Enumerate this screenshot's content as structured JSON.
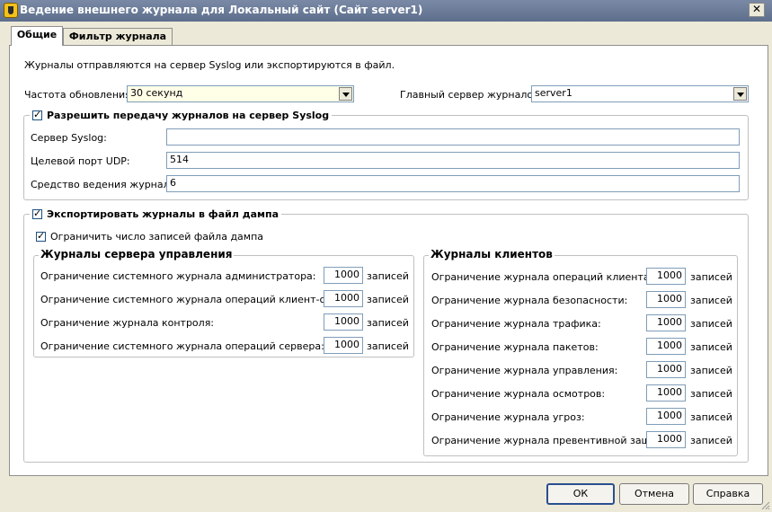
{
  "window": {
    "title": "Ведение внешнего журнала для Локальный сайт (Сайт server1)",
    "close": "✕"
  },
  "tabs": [
    "Общие",
    "Фильтр журнала"
  ],
  "intro": "Журналы отправляются на сервер Syslog или экспортируются в файл.",
  "refresh": {
    "label": "Частота обновления:",
    "value": "30 секунд"
  },
  "main_server": {
    "label": "Главный сервер журналов:",
    "value": "server1"
  },
  "syslog": {
    "enable_label": "Разрешить передачу журналов на сервер Syslog",
    "server_label": "Сервер Syslog:",
    "server_value": "",
    "port_label": "Целевой порт UDP:",
    "port_value": "514",
    "facility_label": "Средство ведения журнала:",
    "facility_value": "6"
  },
  "export": {
    "enable_label": "Экспортировать журналы в файл дампа",
    "limit_label": "Ограничить число записей файла дампа",
    "server_logs": {
      "title": "Журналы сервера управления",
      "rows": [
        {
          "label": "Ограничение системного журнала администратора:",
          "value": "1000",
          "unit": "записей"
        },
        {
          "label": "Ограничение системного журнала операций клиент-сервер:",
          "value": "1000",
          "unit": "записей"
        },
        {
          "label": "Ограничение журнала контроля:",
          "value": "1000",
          "unit": "записей"
        },
        {
          "label": "Ограничение системного журнала операций сервера:",
          "value": "1000",
          "unit": "записей"
        }
      ]
    },
    "client_logs": {
      "title": "Журналы клиентов",
      "rows": [
        {
          "label": "Ограничение журнала операций клиента:",
          "value": "1000",
          "unit": "записей"
        },
        {
          "label": "Ограничение журнала безопасности:",
          "value": "1000",
          "unit": "записей"
        },
        {
          "label": "Ограничение журнала трафика:",
          "value": "1000",
          "unit": "записей"
        },
        {
          "label": "Ограничение журнала пакетов:",
          "value": "1000",
          "unit": "записей"
        },
        {
          "label": "Ограничение журнала управления:",
          "value": "1000",
          "unit": "записей"
        },
        {
          "label": "Ограничение журнала осмотров:",
          "value": "1000",
          "unit": "записей"
        },
        {
          "label": "Ограничение журнала угроз:",
          "value": "1000",
          "unit": "записей"
        },
        {
          "label": "Ограничение журнала превентивной защиты:",
          "value": "1000",
          "unit": "записей"
        }
      ]
    }
  },
  "buttons": {
    "ok": "ОК",
    "cancel": "Отмена",
    "help": "Справка"
  }
}
